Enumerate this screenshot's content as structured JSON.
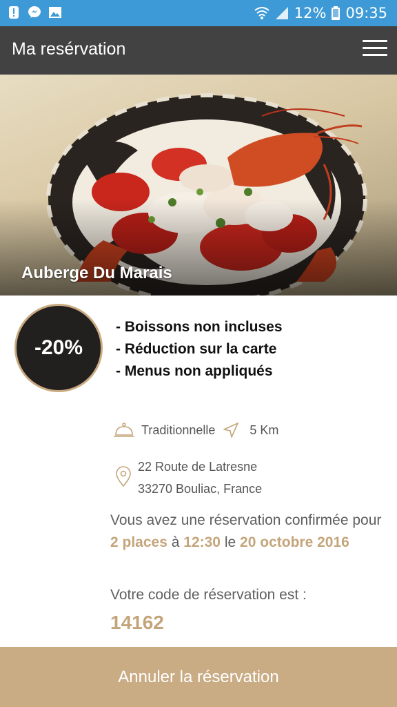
{
  "status_bar": {
    "battery": "12%",
    "time": "09:35",
    "icons": [
      "alert-icon",
      "messenger-icon",
      "image-icon",
      "wifi-icon",
      "signal-icon",
      "battery-icon"
    ]
  },
  "app_bar": {
    "title": "Ma resérvation",
    "menu_icon": "hamburger-menu-icon"
  },
  "restaurant": {
    "name": "Auberge Du Marais",
    "discount": "-20%",
    "conditions": [
      "- Boissons non incluses",
      "- Réduction sur la carte",
      "- Menus non appliqués"
    ],
    "cuisine": "Traditionnelle",
    "distance": "5 Km",
    "address_line1": "22 Route de Latresne",
    "address_line2": "33270 Bouliac, France"
  },
  "reservation": {
    "text_prefix": "Vous avez une réservation confirmée pour",
    "places": "2 places",
    "at": "à",
    "time": "12:30",
    "on": "le",
    "date": "20 octobre 2016",
    "code_label": "Votre code de réservation est :",
    "code": "14162"
  },
  "actions": {
    "cancel_label": "Annuler la réservation"
  },
  "colors": {
    "status_bar": "#3d9ad6",
    "app_bar": "#424242",
    "accent": "#c4a57b",
    "button": "#c9ab84",
    "badge_bg": "#221f1f"
  }
}
